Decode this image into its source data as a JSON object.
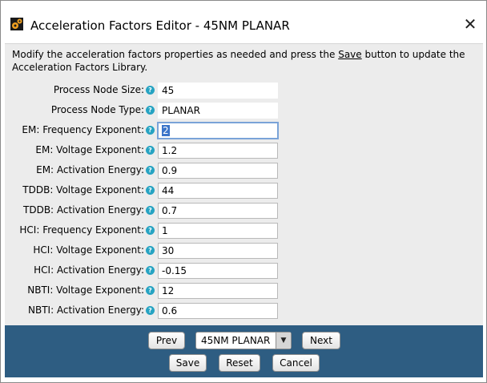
{
  "window": {
    "title": "Acceleration Factors Editor - 45NM PLANAR",
    "close_glyph": "✕"
  },
  "description": {
    "before": "Modify the acceleration factors properties as needed and press the ",
    "link": "Save",
    "after": " button to update the Acceleration Factors Library."
  },
  "help_glyph": "?",
  "fields": [
    {
      "label": "Process Node Size:",
      "value": "45",
      "editable": false
    },
    {
      "label": "Process Node Type:",
      "value": "PLANAR",
      "editable": false
    },
    {
      "label": "EM: Frequency Exponent:",
      "value": "2",
      "editable": true,
      "focused": true
    },
    {
      "label": "EM: Voltage Exponent:",
      "value": "1.2",
      "editable": true
    },
    {
      "label": "EM: Activation Energy:",
      "value": "0.9",
      "editable": true
    },
    {
      "label": "TDDB: Voltage Exponent:",
      "value": "44",
      "editable": true
    },
    {
      "label": "TDDB: Activation Energy:",
      "value": "0.7",
      "editable": true
    },
    {
      "label": "HCI: Frequency Exponent:",
      "value": "1",
      "editable": true
    },
    {
      "label": "HCI: Voltage Exponent:",
      "value": "30",
      "editable": true
    },
    {
      "label": "HCI: Activation Energy:",
      "value": "-0.15",
      "editable": true
    },
    {
      "label": "NBTI: Voltage Exponent:",
      "value": "12",
      "editable": true
    },
    {
      "label": "NBTI: Activation Energy:",
      "value": "0.6",
      "editable": true
    }
  ],
  "footer": {
    "prev_label": "Prev",
    "selector_value": "45NM PLANAR",
    "selector_arrow": "▼",
    "next_label": "Next",
    "save_label": "Save",
    "reset_label": "Reset",
    "cancel_label": "Cancel"
  },
  "colors": {
    "footer_bg": "#2e5d82",
    "help_icon": "#26a3c2",
    "content_bg": "#ececec"
  }
}
